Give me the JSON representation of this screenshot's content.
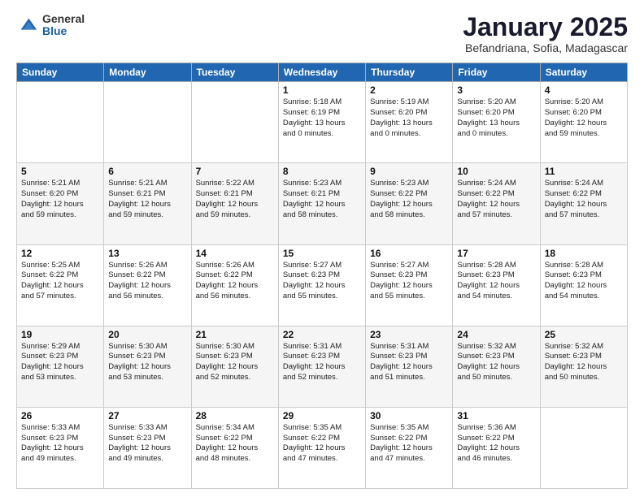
{
  "logo": {
    "general": "General",
    "blue": "Blue"
  },
  "header": {
    "month": "January 2025",
    "location": "Befandriana, Sofia, Madagascar"
  },
  "weekdays": [
    "Sunday",
    "Monday",
    "Tuesday",
    "Wednesday",
    "Thursday",
    "Friday",
    "Saturday"
  ],
  "weeks": [
    [
      {
        "day": "",
        "info": ""
      },
      {
        "day": "",
        "info": ""
      },
      {
        "day": "",
        "info": ""
      },
      {
        "day": "1",
        "info": "Sunrise: 5:18 AM\nSunset: 6:19 PM\nDaylight: 13 hours\nand 0 minutes."
      },
      {
        "day": "2",
        "info": "Sunrise: 5:19 AM\nSunset: 6:20 PM\nDaylight: 13 hours\nand 0 minutes."
      },
      {
        "day": "3",
        "info": "Sunrise: 5:20 AM\nSunset: 6:20 PM\nDaylight: 13 hours\nand 0 minutes."
      },
      {
        "day": "4",
        "info": "Sunrise: 5:20 AM\nSunset: 6:20 PM\nDaylight: 12 hours\nand 59 minutes."
      }
    ],
    [
      {
        "day": "5",
        "info": "Sunrise: 5:21 AM\nSunset: 6:20 PM\nDaylight: 12 hours\nand 59 minutes."
      },
      {
        "day": "6",
        "info": "Sunrise: 5:21 AM\nSunset: 6:21 PM\nDaylight: 12 hours\nand 59 minutes."
      },
      {
        "day": "7",
        "info": "Sunrise: 5:22 AM\nSunset: 6:21 PM\nDaylight: 12 hours\nand 59 minutes."
      },
      {
        "day": "8",
        "info": "Sunrise: 5:23 AM\nSunset: 6:21 PM\nDaylight: 12 hours\nand 58 minutes."
      },
      {
        "day": "9",
        "info": "Sunrise: 5:23 AM\nSunset: 6:22 PM\nDaylight: 12 hours\nand 58 minutes."
      },
      {
        "day": "10",
        "info": "Sunrise: 5:24 AM\nSunset: 6:22 PM\nDaylight: 12 hours\nand 57 minutes."
      },
      {
        "day": "11",
        "info": "Sunrise: 5:24 AM\nSunset: 6:22 PM\nDaylight: 12 hours\nand 57 minutes."
      }
    ],
    [
      {
        "day": "12",
        "info": "Sunrise: 5:25 AM\nSunset: 6:22 PM\nDaylight: 12 hours\nand 57 minutes."
      },
      {
        "day": "13",
        "info": "Sunrise: 5:26 AM\nSunset: 6:22 PM\nDaylight: 12 hours\nand 56 minutes."
      },
      {
        "day": "14",
        "info": "Sunrise: 5:26 AM\nSunset: 6:22 PM\nDaylight: 12 hours\nand 56 minutes."
      },
      {
        "day": "15",
        "info": "Sunrise: 5:27 AM\nSunset: 6:23 PM\nDaylight: 12 hours\nand 55 minutes."
      },
      {
        "day": "16",
        "info": "Sunrise: 5:27 AM\nSunset: 6:23 PM\nDaylight: 12 hours\nand 55 minutes."
      },
      {
        "day": "17",
        "info": "Sunrise: 5:28 AM\nSunset: 6:23 PM\nDaylight: 12 hours\nand 54 minutes."
      },
      {
        "day": "18",
        "info": "Sunrise: 5:28 AM\nSunset: 6:23 PM\nDaylight: 12 hours\nand 54 minutes."
      }
    ],
    [
      {
        "day": "19",
        "info": "Sunrise: 5:29 AM\nSunset: 6:23 PM\nDaylight: 12 hours\nand 53 minutes."
      },
      {
        "day": "20",
        "info": "Sunrise: 5:30 AM\nSunset: 6:23 PM\nDaylight: 12 hours\nand 53 minutes."
      },
      {
        "day": "21",
        "info": "Sunrise: 5:30 AM\nSunset: 6:23 PM\nDaylight: 12 hours\nand 52 minutes."
      },
      {
        "day": "22",
        "info": "Sunrise: 5:31 AM\nSunset: 6:23 PM\nDaylight: 12 hours\nand 52 minutes."
      },
      {
        "day": "23",
        "info": "Sunrise: 5:31 AM\nSunset: 6:23 PM\nDaylight: 12 hours\nand 51 minutes."
      },
      {
        "day": "24",
        "info": "Sunrise: 5:32 AM\nSunset: 6:23 PM\nDaylight: 12 hours\nand 50 minutes."
      },
      {
        "day": "25",
        "info": "Sunrise: 5:32 AM\nSunset: 6:23 PM\nDaylight: 12 hours\nand 50 minutes."
      }
    ],
    [
      {
        "day": "26",
        "info": "Sunrise: 5:33 AM\nSunset: 6:23 PM\nDaylight: 12 hours\nand 49 minutes."
      },
      {
        "day": "27",
        "info": "Sunrise: 5:33 AM\nSunset: 6:23 PM\nDaylight: 12 hours\nand 49 minutes."
      },
      {
        "day": "28",
        "info": "Sunrise: 5:34 AM\nSunset: 6:22 PM\nDaylight: 12 hours\nand 48 minutes."
      },
      {
        "day": "29",
        "info": "Sunrise: 5:35 AM\nSunset: 6:22 PM\nDaylight: 12 hours\nand 47 minutes."
      },
      {
        "day": "30",
        "info": "Sunrise: 5:35 AM\nSunset: 6:22 PM\nDaylight: 12 hours\nand 47 minutes."
      },
      {
        "day": "31",
        "info": "Sunrise: 5:36 AM\nSunset: 6:22 PM\nDaylight: 12 hours\nand 46 minutes."
      },
      {
        "day": "",
        "info": ""
      }
    ]
  ]
}
